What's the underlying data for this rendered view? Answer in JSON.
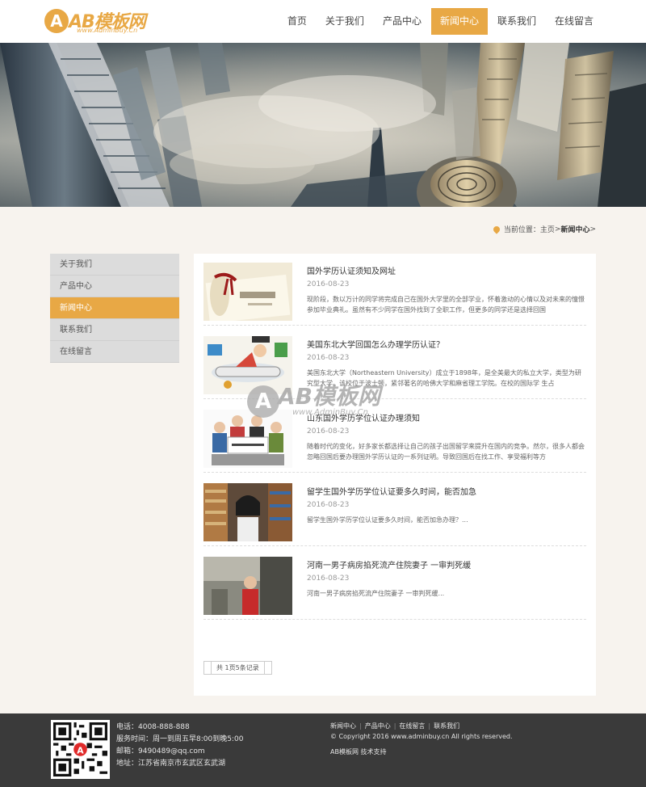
{
  "header": {
    "logo_mark": "A",
    "logo_title": "AB模板网",
    "logo_sub": "www.AdminBuy.Cn",
    "nav": [
      {
        "label": "首页"
      },
      {
        "label": "关于我们"
      },
      {
        "label": "产品中心"
      },
      {
        "label": "新闻中心",
        "active": true
      },
      {
        "label": "联系我们"
      },
      {
        "label": "在线留言"
      }
    ]
  },
  "breadcrumb": {
    "prefix": "当前位置：",
    "home": "主页",
    "sep1": " > ",
    "current": "新闻中心",
    "sep2": " >"
  },
  "sidebar": {
    "items": [
      {
        "label": "关于我们"
      },
      {
        "label": "产品中心"
      },
      {
        "label": "新闻中心",
        "active": true
      },
      {
        "label": "联系我们"
      },
      {
        "label": "在线留言"
      }
    ]
  },
  "news": [
    {
      "title": "国外学历认证须知及网址",
      "date": "2016-08-23",
      "summary": "现阶段，数以万计的同学将完成自己在国外大学里的全部学业，怀着激动的心情以及对未来的憧憬参加毕业典礼。虽然有不少同学在国外找到了全职工作，但更多的同学还是选择回国"
    },
    {
      "title": "美国东北大学回国怎么办理学历认证？",
      "date": "2016-08-23",
      "summary": "美国东北大学（Northeastern University）成立于1898年，是全美最大的私立大学，类型为研究型大学。该校位于波士顿，紧邻著名的哈佛大学和麻省理工学院。在校的国际学 生占"
    },
    {
      "title": "山东国外学历学位认证办理须知",
      "date": "2016-08-23",
      "summary": "随着时代的变化，好多家长都选择让自己的孩子出国留学来提升在国内的竞争。然尔，很多人都会忽略回国后要办理国外学历认证的一系列证明。导致回国后在找工作、享受福利等方"
    },
    {
      "title": "留学生国外学历学位认证要多久时间，能否加急",
      "date": "2016-08-23",
      "summary": "留学生国外学历学位认证要多久时间，能否加急办理？..."
    },
    {
      "title": "河南一男子病房掐死流产住院妻子 一审判死缓",
      "date": "2016-08-23",
      "summary": "河南一男子病房掐死流产住院妻子 一审判死缓..."
    }
  ],
  "pager": {
    "label": "共 1页5条记录"
  },
  "watermark": {
    "mark": "A",
    "title": "AB模板网",
    "sub": "www.AdminBuy.Cn"
  },
  "footer": {
    "phone": "电话：4008-888-888",
    "hours": "服务时间：周一到周五早8:00到晚5:00",
    "email": "邮箱：9490489@qq.com",
    "address": "地址：江苏省南京市玄武区玄武湖",
    "links": [
      {
        "label": "新闻中心"
      },
      {
        "label": "产品中心"
      },
      {
        "label": "在线留言"
      },
      {
        "label": "联系我们"
      }
    ],
    "copyright": "© Copyright 2016 www.adminbuy.cn All rights reserved.",
    "support": "AB模板网 技术支持"
  },
  "colors": {
    "accent": "#e8a845",
    "footer_bg": "#3a3a3a",
    "page_bg": "#f7f3ee",
    "sidebar_bg": "#dcdcdc"
  },
  "icons": {
    "breadcrumb": "location-pin-icon"
  }
}
